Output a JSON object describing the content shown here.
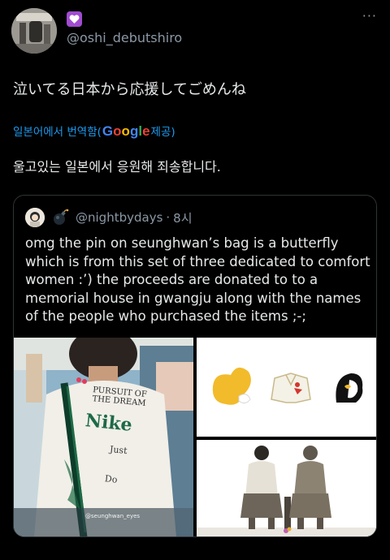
{
  "tweet": {
    "handle": "@oshi_debutshiro",
    "text": "泣いてる日本から応援してごめんね",
    "translate": {
      "prefix": "일본어에서 번역함(",
      "brand": "Google",
      "suffix": " 제공)"
    },
    "translated_text": "울고있는 일본에서 응원해 죄송합니다.",
    "more_label": "···"
  },
  "quote": {
    "handle": "@nightbydays",
    "separator": "·",
    "time": "8시",
    "text": "omg the pin on seunghwan’s bag is a butterfly which is from this set of three dedicated to comfort women :’) the proceeds are donated to to a memorial house in gwangju along with the names of the people who purchased the items ;-;"
  },
  "media": {
    "shirt": {
      "line1": "PURSUIT OF",
      "line2": "THE DREAM",
      "brand": "Nike",
      "word1": "Just",
      "word2": "Do",
      "watermark": "@seunghwan_eyes"
    }
  },
  "colors": {
    "background": "#000000",
    "text": "#e7e9ea",
    "muted": "#8b98a5",
    "link": "#1d9bf0",
    "border": "#2f3336",
    "badge": "#a04cd0"
  },
  "icons": {
    "badge": "heart-icon",
    "more": "more-icon",
    "bomb": "bomb-icon"
  }
}
